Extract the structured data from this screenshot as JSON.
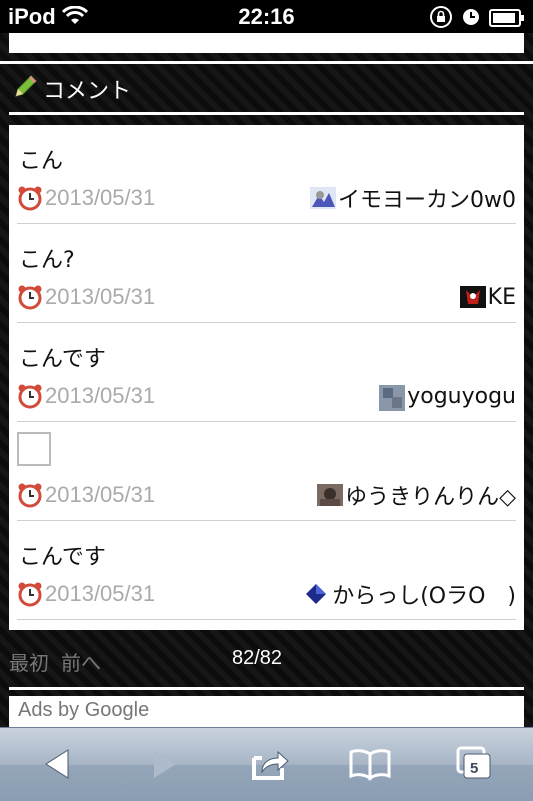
{
  "status_bar": {
    "carrier": "iPod",
    "time": "22:16"
  },
  "section": {
    "title": "コメント"
  },
  "comments": [
    {
      "text": "こん",
      "date": "2013/05/31",
      "user": "イモヨーカン0w0"
    },
    {
      "text": "こん?",
      "date": "2013/05/31",
      "user": "KE"
    },
    {
      "text": "こんです",
      "date": "2013/05/31",
      "user": "yoguyogu"
    },
    {
      "text": "",
      "date": "2013/05/31",
      "user": "ゆうきりんりん◇"
    },
    {
      "text": "こんです",
      "date": "2013/05/31",
      "user": "からっし(OラO　)"
    }
  ],
  "pager": {
    "first": "最初",
    "prev": "前へ",
    "count": "82/82"
  },
  "ads": {
    "label": "Ads by Google"
  },
  "toolbar": {
    "tabs_count": "5"
  },
  "icons": [
    "wifi-icon",
    "rotation-lock-icon",
    "clock-status-icon",
    "battery-icon",
    "pencil-icon",
    "alarm-clock-icon",
    "back-icon",
    "forward-icon",
    "share-icon",
    "bookmarks-icon",
    "tabs-icon"
  ]
}
